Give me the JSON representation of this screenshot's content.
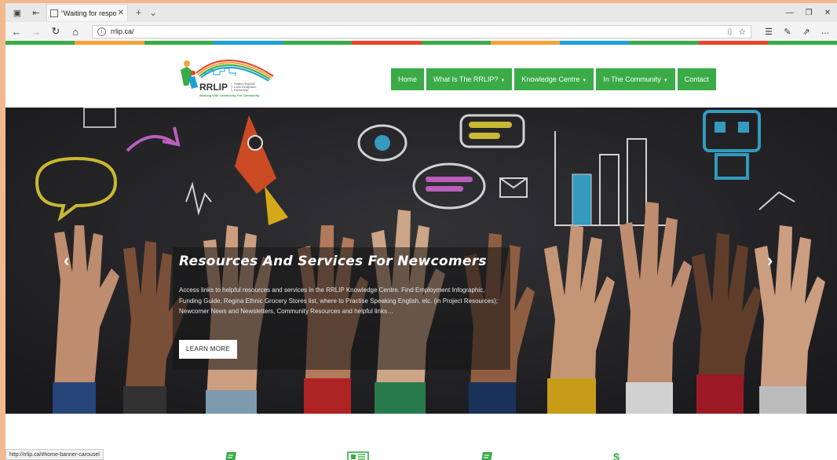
{
  "browser": {
    "tab_title": "“Waiting for response fr",
    "url": "rrlip.ca/",
    "status_url": "http://rrlip.ca/#home-banner-carousel"
  },
  "colors": {
    "nav_green": "#3aab47",
    "stripe": [
      "#3aab47",
      "#f2a33a",
      "#3aab47",
      "#1e9fd8",
      "#3aab47",
      "#e8452c",
      "#3aab47",
      "#f2a33a",
      "#1e9fd8",
      "#3aab47",
      "#e8452c",
      "#3aab47"
    ]
  },
  "logo": {
    "text": "RRLIP",
    "subtitle": "Regina Regional Local Immigration Partnership",
    "tagline": "Working With Community, For Community"
  },
  "nav": [
    {
      "label": "Home",
      "dropdown": false
    },
    {
      "label": "What Is The RRLIP?",
      "dropdown": true
    },
    {
      "label": "Knowledge Centre",
      "dropdown": true
    },
    {
      "label": "In The Community",
      "dropdown": true
    },
    {
      "label": "Contact",
      "dropdown": false
    }
  ],
  "hero": {
    "title": "Resources And Services For Newcomers",
    "text": "Access links to helpful resources and services in the RRLIP Knowledge Centre. Find Employment Infographic, Funding Guide, Regina Ethnic Grocery Stores list, where to Practise Speaking English, etc. (in Project Resources); Newcomer News and Newsletters, Community Resources and helpful links…",
    "button": "LEARN MORE"
  },
  "features": [
    {
      "icon": "book-icon"
    },
    {
      "icon": "newspaper-icon"
    },
    {
      "icon": "book-icon"
    },
    {
      "icon": "dollar-icon"
    }
  ]
}
